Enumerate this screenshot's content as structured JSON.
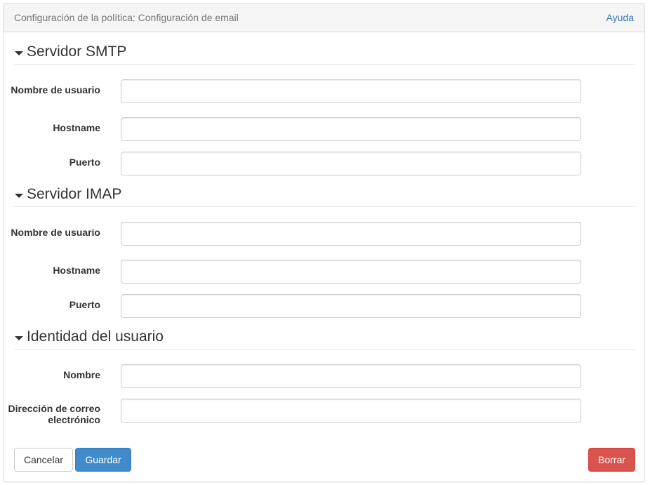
{
  "header": {
    "title": "Configuración de la política: Configuración de email",
    "help_label": "Ayuda"
  },
  "sections": [
    {
      "title": "Servidor SMTP",
      "fields": [
        {
          "label": "Nombre de usuario",
          "value": ""
        },
        {
          "label": "Hostname",
          "value": ""
        },
        {
          "label": "Puerto",
          "value": ""
        }
      ]
    },
    {
      "title": "Servidor IMAP",
      "fields": [
        {
          "label": "Nombre de usuario",
          "value": ""
        },
        {
          "label": "Hostname",
          "value": ""
        },
        {
          "label": "Puerto",
          "value": ""
        }
      ]
    },
    {
      "title": "Identidad del usuario",
      "fields": [
        {
          "label": "Nombre",
          "value": ""
        },
        {
          "label": "Dirección de correo electrónico",
          "value": ""
        }
      ]
    }
  ],
  "actions": {
    "cancel_label": "Cancelar",
    "save_label": "Guardar",
    "delete_label": "Borrar"
  },
  "colors": {
    "primary": "#428bca",
    "danger": "#d9534f",
    "link": "#337ab7"
  }
}
